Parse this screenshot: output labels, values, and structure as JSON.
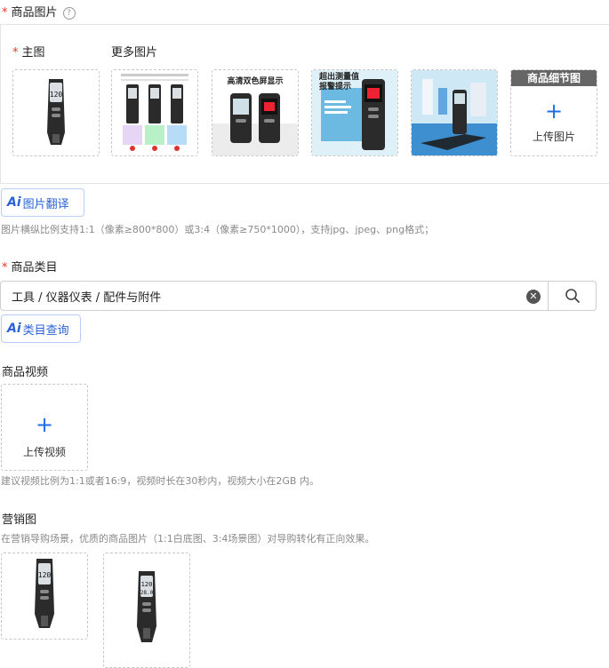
{
  "images": {
    "title": "商品图片",
    "main_label": "主图",
    "more_label": "更多图片",
    "thumb2_texts": [
      "高清双色屏显示"
    ],
    "thumb3_texts": [
      "超出测量值",
      "报警提示"
    ],
    "detail_tag": "商品细节图",
    "upload_label": "上传图片",
    "ai_translate": "图片翻译",
    "hint": "图片横纵比例支持1:1（像素≥800*800）或3:4（像素≥750*1000），支持jpg、jpeg、png格式；"
  },
  "category": {
    "title": "商品类目",
    "value": "工具 / 仪器仪表 / 配件与附件",
    "ai_lookup": "类目查询"
  },
  "video": {
    "title": "商品视频",
    "upload_label": "上传视频",
    "hint": "建议视频比例为1:1或者16:9，视频时长在30秒内，视频大小在2GB 内。"
  },
  "marketing": {
    "title": "营销图",
    "hint": "在营销导购场景，优质的商品图片（1:1白底图、3:4场景图）对导购转化有正向效果。"
  },
  "colors": {
    "accent": "#1e6fe8",
    "required": "#e5322d"
  },
  "ai_logo": "Ai",
  "screen_values": {
    "m1": "120",
    "m2": "28.0"
  }
}
